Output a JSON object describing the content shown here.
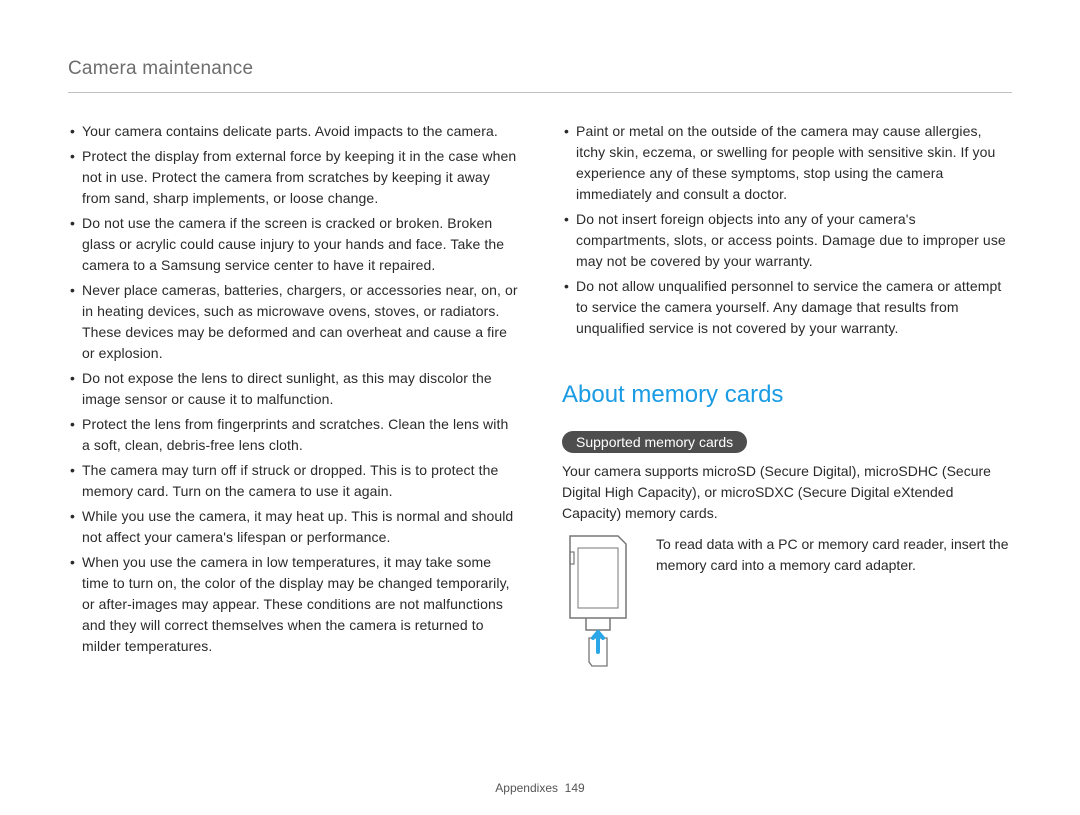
{
  "header": {
    "title": "Camera maintenance"
  },
  "left_column": {
    "bullets": [
      "Your camera contains delicate parts. Avoid impacts to the camera.",
      "Protect the display from external force by keeping it in the case when not in use. Protect the camera from scratches by keeping it away from sand, sharp implements, or loose change.",
      "Do not use the camera if the screen is cracked or broken. Broken glass or acrylic could cause injury to your hands and face. Take the camera to a Samsung service center to have it repaired.",
      "Never place cameras, batteries, chargers, or accessories near, on, or in heating devices, such as microwave ovens, stoves, or radiators. These devices may be deformed and can overheat and cause a fire or explosion.",
      "Do not expose the lens to direct sunlight, as this may discolor the image sensor or cause it to malfunction.",
      "Protect the lens from fingerprints and scratches. Clean the lens with a soft, clean, debris-free lens cloth.",
      "The camera may turn off if struck or dropped. This is to protect the memory card. Turn on the camera to use it again.",
      "While you use the camera, it may heat up. This is normal and should not affect your camera's lifespan or performance.",
      "When you use the camera in low temperatures, it may take some time to turn on, the color of the display may be changed temporarily, or after-images may appear. These conditions are not malfunctions and they will correct themselves when the camera is returned to milder temperatures."
    ]
  },
  "right_column": {
    "bullets": [
      "Paint or metal on the outside of the camera may cause allergies, itchy skin, eczema, or swelling for people with sensitive skin. If you experience any of these symptoms, stop using the camera immediately and consult a doctor.",
      "Do not insert foreign objects into any of your camera's compartments, slots, or access points. Damage due to improper use may not be covered by your warranty.",
      "Do not allow unqualified personnel to service the camera or attempt to service the camera yourself. Any damage that results from unqualified service is not covered by your warranty."
    ],
    "section_heading": "About memory cards",
    "subheading": "Supported memory cards",
    "support_text": "Your camera supports microSD (Secure Digital), microSDHC (Secure Digital High Capacity), or microSDXC (Secure Digital eXtended Capacity) memory cards.",
    "adapter_text": "To read data with a PC or memory card reader, insert the memory card into a memory card adapter."
  },
  "footer": {
    "section": "Appendixes",
    "page_number": "149"
  }
}
